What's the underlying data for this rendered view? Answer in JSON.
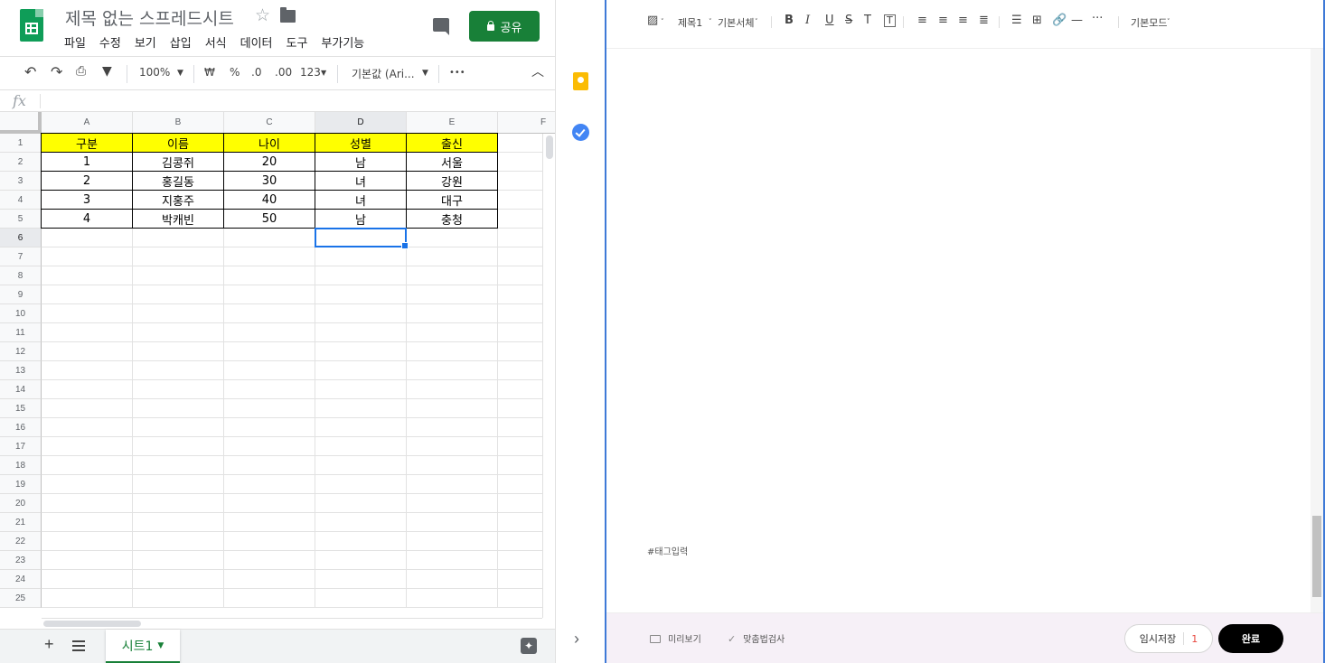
{
  "sheets": {
    "title": "제목 없는 스프레드시트",
    "menu": [
      "파일",
      "수정",
      "보기",
      "삽입",
      "서식",
      "데이터",
      "도구",
      "부가기능"
    ],
    "share_label": "공유",
    "toolbar": {
      "zoom": "100%",
      "currency": "₩",
      "percent": "%",
      "dec_decrease": ".0",
      "dec_increase": ".00",
      "number_format": "123",
      "font": "기본값 (Ari...",
      "more": "•••"
    },
    "fx_label": "fx",
    "columns": [
      "A",
      "B",
      "C",
      "D",
      "E",
      "F"
    ],
    "selected_column": "D",
    "rows": [
      "1",
      "2",
      "3",
      "4",
      "5",
      "6",
      "7",
      "8",
      "9",
      "10",
      "11",
      "12",
      "13",
      "14",
      "15",
      "16",
      "17",
      "18",
      "19",
      "20",
      "21",
      "22",
      "23",
      "24",
      "25"
    ],
    "selected_row": "6",
    "table_header": [
      "구분",
      "이름",
      "나이",
      "성별",
      "출신"
    ],
    "table_rows": [
      [
        "1",
        "김콩쥐",
        "20",
        "남",
        "서울"
      ],
      [
        "2",
        "홍길동",
        "30",
        "녀",
        "강원"
      ],
      [
        "3",
        "지홍주",
        "40",
        "녀",
        "대구"
      ],
      [
        "4",
        "박캐빈",
        "50",
        "남",
        "충청"
      ]
    ],
    "header_color": "#ffff00",
    "sheet_tab": "시트1",
    "accent_color": "#188038"
  },
  "sidepanel": {
    "icons": [
      "keep-icon",
      "tasks-icon",
      "expand-icon"
    ]
  },
  "editor": {
    "toolbar": {
      "heading": "제목1",
      "font": "기본서체",
      "bold": "B",
      "italic": "I",
      "underline": "U",
      "strike": "S",
      "text_color": "T",
      "text_bg": "T",
      "mode": "기본모드"
    },
    "tag_placeholder": "#태그입력",
    "preview_label": "미리보기",
    "spellcheck_label": "맞춤법검사",
    "draft_label": "임시저장",
    "draft_count": "1",
    "done_label": "완료",
    "border_color": "#3f7ad7"
  }
}
